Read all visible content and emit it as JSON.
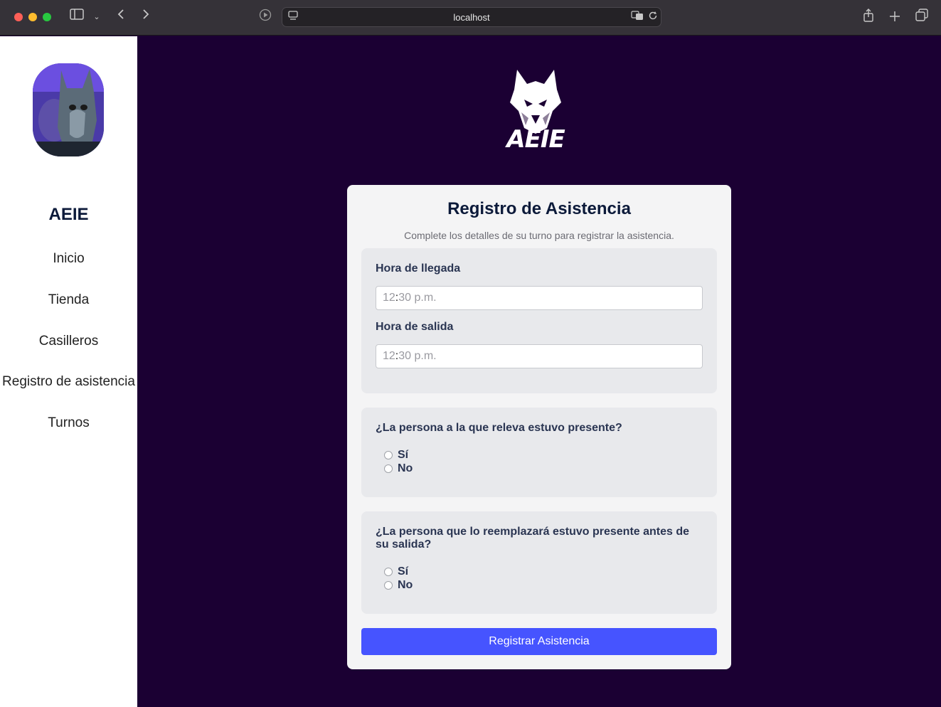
{
  "browser": {
    "url": "localhost"
  },
  "sidebar": {
    "brand": "AEIE",
    "items": [
      {
        "label": "Inicio"
      },
      {
        "label": "Tienda"
      },
      {
        "label": "Casilleros"
      },
      {
        "label": "Registro de asistencia"
      },
      {
        "label": "Turnos"
      }
    ]
  },
  "logo": {
    "text": "AEIE"
  },
  "form": {
    "title": "Registro de Asistencia",
    "subtitle": "Complete los detalles de su turno para registrar la asistencia.",
    "arrival": {
      "label": "Hora de llegada",
      "hour": "12",
      "minute": "30 p.m."
    },
    "departure": {
      "label": "Hora de salida",
      "hour": "12",
      "minute": "30 p.m."
    },
    "q1": {
      "text": "¿La persona a la que releva estuvo presente?",
      "options": [
        "Sí",
        "No"
      ]
    },
    "q2": {
      "text": "¿La persona que lo reemplazará estuvo presente antes de su salida?",
      "options": [
        "Sí",
        "No"
      ]
    },
    "submit_label": "Registrar Asistencia"
  },
  "colors": {
    "main_bg": "#1b0033",
    "button": "#4654ff",
    "heading": "#0c1a3a"
  }
}
